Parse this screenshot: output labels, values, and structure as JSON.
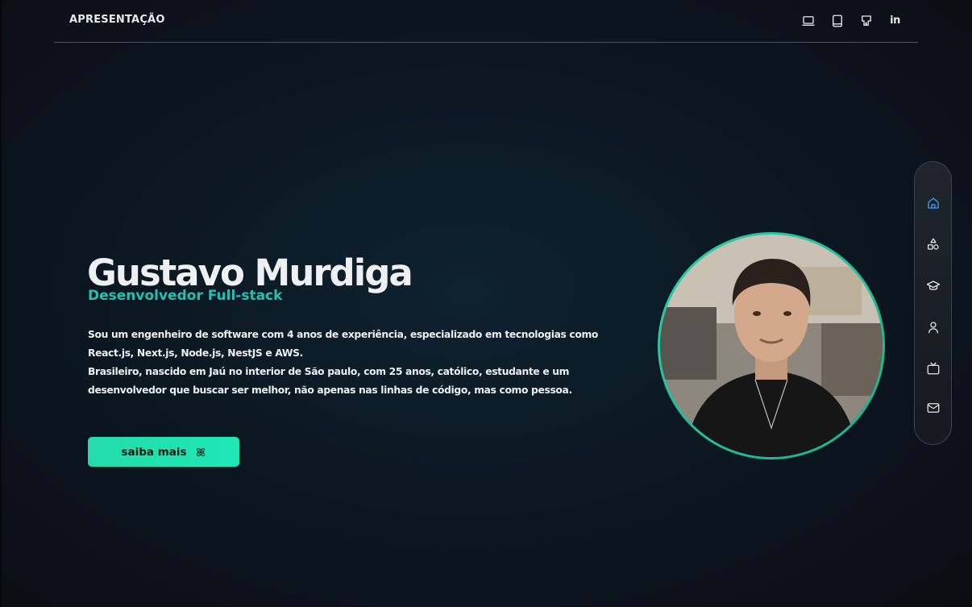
{
  "header": {
    "title": "APRESENTAÇÃO",
    "icons": [
      {
        "name": "laptop-icon"
      },
      {
        "name": "tablet-icon"
      },
      {
        "name": "github-icon"
      },
      {
        "name": "linkedin-icon",
        "text": "in"
      }
    ]
  },
  "hero": {
    "name": "Gustavo Murdiga",
    "role": "Desenvolvedor Full-stack",
    "bio_line1": "Sou um engenheiro de software com 4 anos de experiência, especializado em tecnologias como React.js, Next.js, Node.js, NestJS e AWS.",
    "bio_line2": "Brasileiro, nascido em Jaú no interior de São paulo, com 25 anos, católico, estudante e um desenvolvedor que buscar ser melhor, não apenas nas linhas de código, mas como pessoa.",
    "button_label": "saiba mais",
    "button_icon": "atom-icon"
  },
  "sidenav": {
    "items": [
      {
        "name": "home-icon",
        "active": true
      },
      {
        "name": "shapes-icon",
        "active": false
      },
      {
        "name": "graduation-cap-icon",
        "active": false
      },
      {
        "name": "user-icon",
        "active": false
      },
      {
        "name": "tv-icon",
        "active": false
      },
      {
        "name": "mail-icon",
        "active": false
      }
    ]
  },
  "colors": {
    "accent_teal": "#1fc3b3",
    "button_green": "#1ee7b6",
    "active_blue": "#3ea3ff",
    "background": "#0b1822"
  }
}
